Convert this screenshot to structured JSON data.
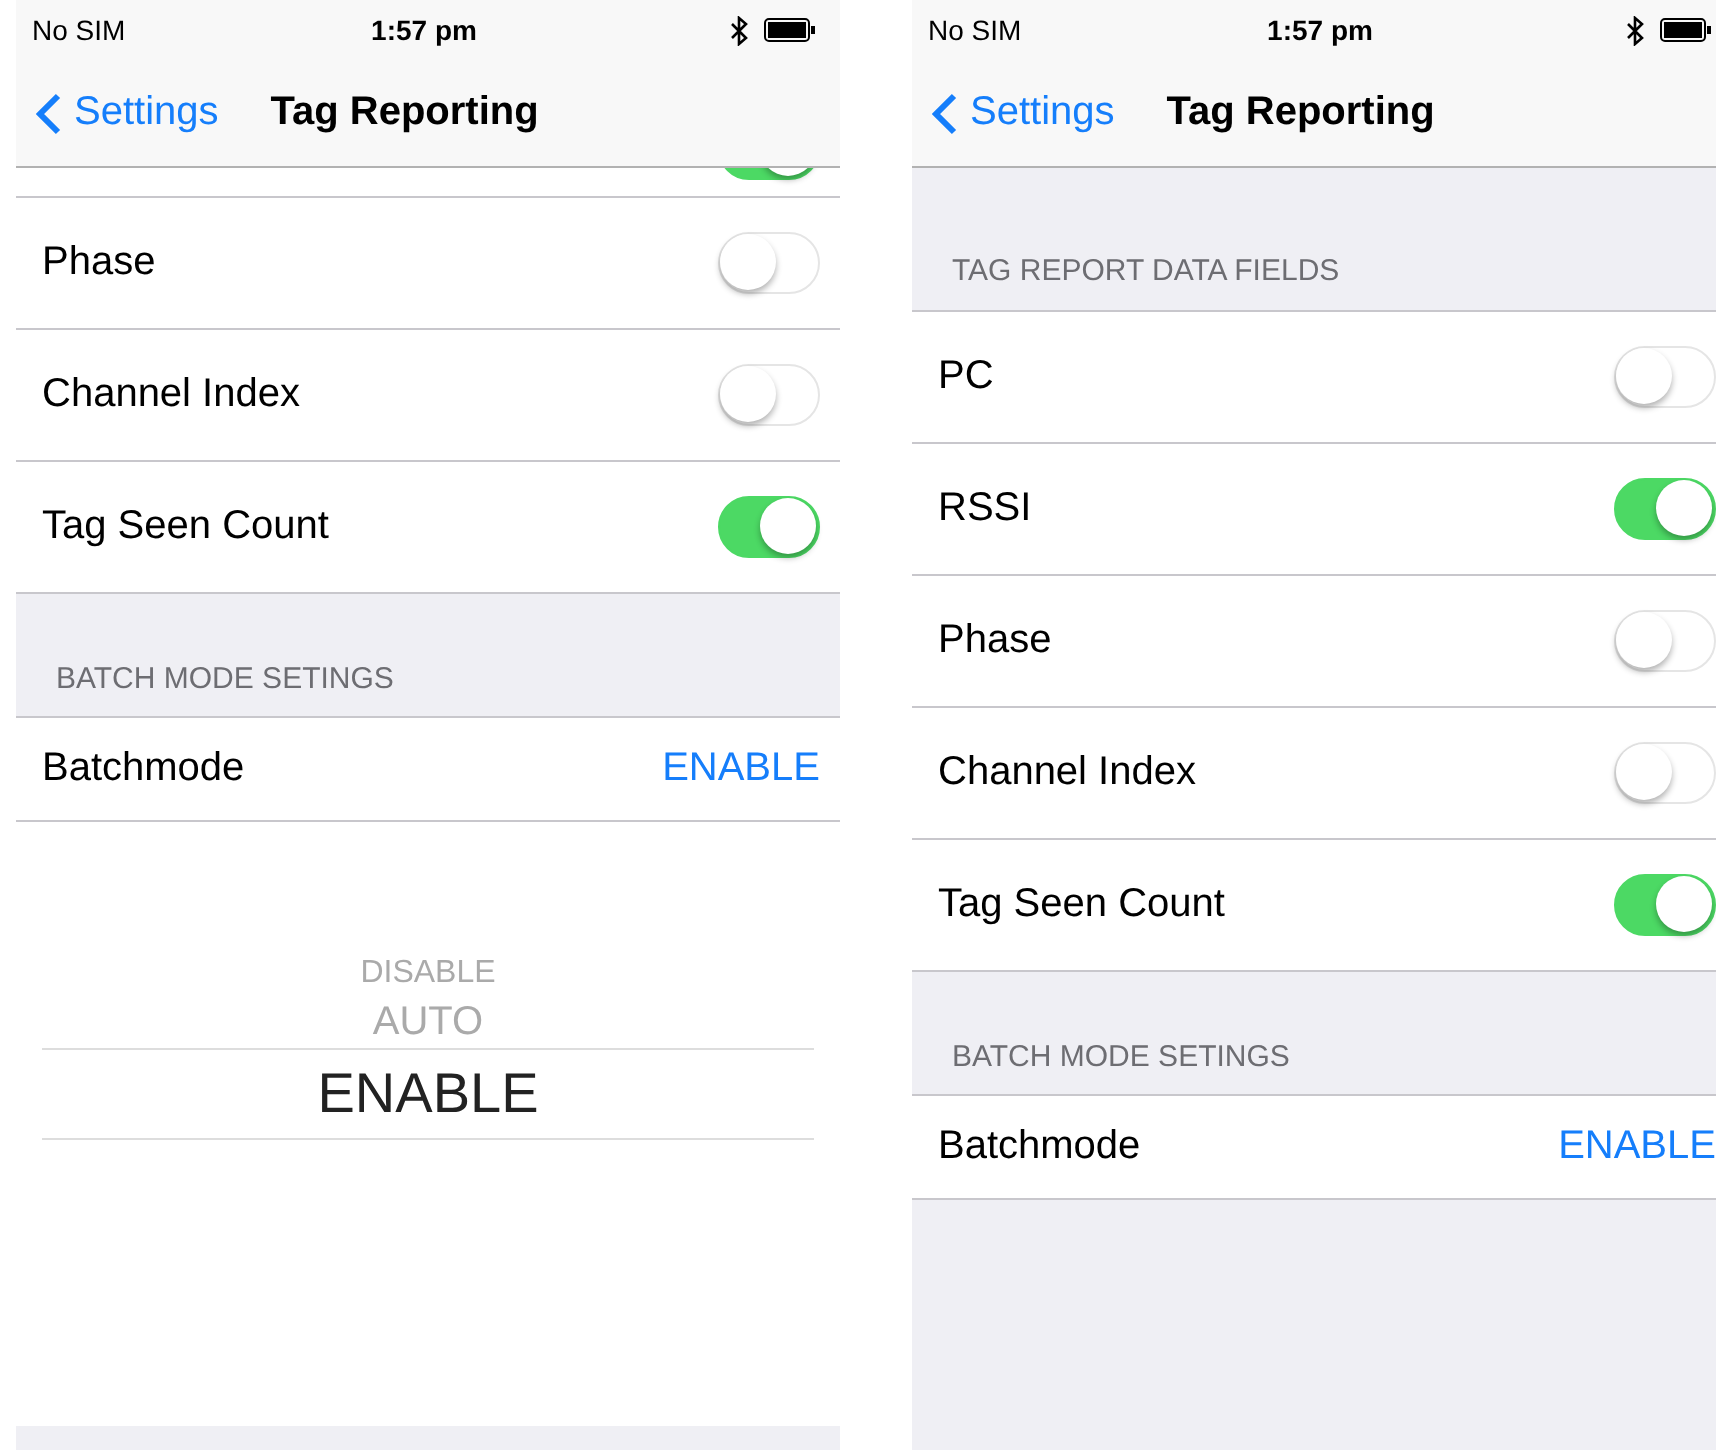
{
  "screens": [
    {
      "status_bar": {
        "carrier": "No SIM",
        "time": "1:57 pm"
      },
      "nav": {
        "back": "Settings",
        "title": "Tag Reporting"
      },
      "items": [
        {
          "kind": "cut-toggle",
          "on": true
        },
        {
          "kind": "toggle",
          "label": "Phase",
          "on": false
        },
        {
          "kind": "toggle",
          "label": "Channel Index",
          "on": false
        },
        {
          "kind": "toggle",
          "label": "Tag Seen Count",
          "on": true
        },
        {
          "kind": "header",
          "label": "BATCH MODE SETINGS"
        },
        {
          "kind": "value",
          "label": "Batchmode",
          "value": "ENABLE"
        },
        {
          "kind": "picker",
          "options": [
            {
              "label": "DISABLE",
              "selected": false
            },
            {
              "label": "AUTO",
              "selected": false
            },
            {
              "label": "ENABLE",
              "selected": true
            }
          ]
        }
      ]
    },
    {
      "status_bar": {
        "carrier": "No SIM",
        "time": "1:57 pm"
      },
      "nav": {
        "back": "Settings",
        "title": "Tag Reporting"
      },
      "items": [
        {
          "kind": "header",
          "label": "TAG REPORT DATA FIELDS"
        },
        {
          "kind": "toggle",
          "label": "PC",
          "on": false
        },
        {
          "kind": "toggle",
          "label": "RSSI",
          "on": true
        },
        {
          "kind": "toggle",
          "label": "Phase",
          "on": false
        },
        {
          "kind": "toggle",
          "label": "Channel Index",
          "on": false
        },
        {
          "kind": "toggle",
          "label": "Tag Seen Count",
          "on": true
        },
        {
          "kind": "header",
          "label": "BATCH MODE SETINGS"
        },
        {
          "kind": "value",
          "label": "Batchmode",
          "value": "ENABLE"
        }
      ]
    }
  ]
}
